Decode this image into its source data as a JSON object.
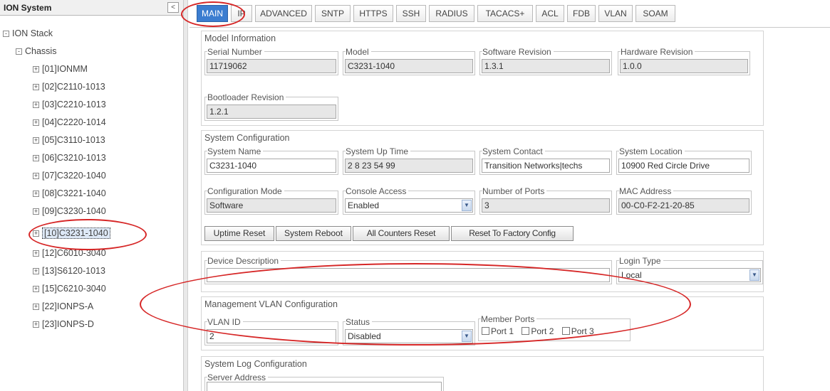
{
  "tree": {
    "title": "ION System",
    "collapse_glyph": "<",
    "root": {
      "label": "ION Stack",
      "toggle": "-"
    },
    "chassis": {
      "label": "Chassis",
      "toggle": "-"
    },
    "items": [
      {
        "label": "[01]IONMM",
        "toggle": "+"
      },
      {
        "label": "[02]C2110-1013",
        "toggle": "+"
      },
      {
        "label": "[03]C2210-1013",
        "toggle": "+"
      },
      {
        "label": "[04]C2220-1014",
        "toggle": "+"
      },
      {
        "label": "[05]C3110-1013",
        "toggle": "+"
      },
      {
        "label": "[06]C3210-1013",
        "toggle": "+"
      },
      {
        "label": "[07]C3220-1040",
        "toggle": "+"
      },
      {
        "label": "[08]C3221-1040",
        "toggle": "+"
      },
      {
        "label": "[09]C3230-1040",
        "toggle": "+"
      },
      {
        "label": "[10]C3231-1040",
        "toggle": "+",
        "selected": true
      },
      {
        "label": "[12]C6010-3040",
        "toggle": "+"
      },
      {
        "label": "[13]S6120-1013",
        "toggle": "+"
      },
      {
        "label": "[15]C6210-3040",
        "toggle": "+"
      },
      {
        "label": "[22]IONPS-A",
        "toggle": "+"
      },
      {
        "label": "[23]IONPS-D",
        "toggle": "+"
      }
    ]
  },
  "tabs": [
    {
      "label": "MAIN",
      "active": true
    },
    {
      "label": "IP"
    },
    {
      "label": "ADVANCED"
    },
    {
      "label": "SNTP"
    },
    {
      "label": "HTTPS"
    },
    {
      "label": "SSH"
    },
    {
      "label": "RADIUS"
    },
    {
      "label": "TACACS+"
    },
    {
      "label": "ACL"
    },
    {
      "label": "FDB"
    },
    {
      "label": "VLAN"
    },
    {
      "label": "SOAM"
    }
  ],
  "model_info": {
    "title": "Model Information",
    "serial_number": {
      "label": "Serial Number",
      "value": "11719062"
    },
    "model": {
      "label": "Model",
      "value": "C3231-1040"
    },
    "software_revision": {
      "label": "Software Revision",
      "value": "1.3.1"
    },
    "hardware_revision": {
      "label": "Hardware Revision",
      "value": "1.0.0"
    },
    "bootloader_revision": {
      "label": "Bootloader Revision",
      "value": "1.2.1"
    }
  },
  "system_config": {
    "title": "System Configuration",
    "system_name": {
      "label": "System Name",
      "value": "C3231-1040"
    },
    "system_up_time": {
      "label": "System Up Time",
      "value": "2 8 23 54 99"
    },
    "system_contact": {
      "label": "System Contact",
      "value": "Transition Networks|techs"
    },
    "system_location": {
      "label": "System Location",
      "value": "10900 Red Circle Drive"
    },
    "configuration_mode": {
      "label": "Configuration Mode",
      "value": "Software"
    },
    "console_access": {
      "label": "Console Access",
      "value": "Enabled"
    },
    "number_of_ports": {
      "label": "Number of Ports",
      "value": "3"
    },
    "mac_address": {
      "label": "MAC Address",
      "value": "00-C0-F2-21-20-85"
    },
    "buttons": {
      "uptime_reset": "Uptime Reset",
      "system_reboot": "System Reboot",
      "all_counters_reset": "All Counters Reset",
      "reset_to_factory": "Reset To Factory Config"
    }
  },
  "device": {
    "description": {
      "label": "Device Description",
      "value": ""
    },
    "login_type": {
      "label": "Login Type",
      "value": "Local"
    }
  },
  "mgmt_vlan": {
    "title": "Management VLAN Configuration",
    "vlan_id": {
      "label": "VLAN ID",
      "value": "2"
    },
    "status": {
      "label": "Status",
      "value": "Disabled"
    },
    "member_ports": {
      "label": "Member Ports",
      "ports": [
        {
          "label": "Port 1",
          "checked": false
        },
        {
          "label": "Port 2",
          "checked": false
        },
        {
          "label": "Port 3",
          "checked": false
        }
      ]
    }
  },
  "syslog": {
    "title": "System Log Configuration",
    "server_address": {
      "label": "Server Address",
      "value": ""
    }
  },
  "icons": {
    "select_arrow": "chevron-down-icon",
    "tree_toggle": "tree-expand-icon"
  },
  "colors": {
    "active_tab": "#3b7dd0",
    "annotation": "#d62626",
    "selected_row": "#dde8f6"
  }
}
